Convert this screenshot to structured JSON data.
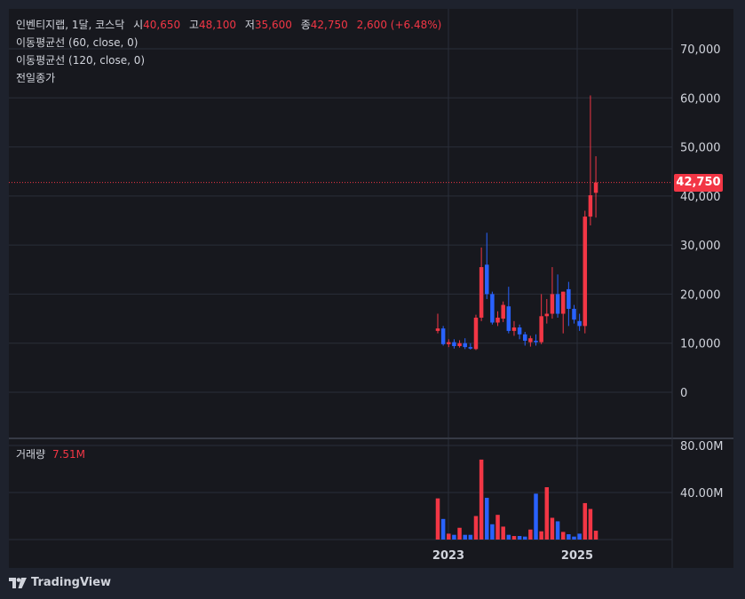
{
  "legend": {
    "symbol": "인벤티지랩, 1달, 코스닥",
    "open_label": "시",
    "open": "40,650",
    "high_label": "고",
    "high": "48,100",
    "low_label": "저",
    "low": "35,600",
    "close_label": "종",
    "close": "42,750",
    "change": "2,600 (+6.48%)",
    "indicators": [
      "이동평균선 (60, close, 0)",
      "이동평균선 (120, close, 0)",
      "전일종가"
    ]
  },
  "volume_legend": {
    "label": "거래량",
    "value": "7.51M"
  },
  "last_price_tag": "42,750",
  "brand": "TradingView",
  "colors": {
    "up": "#f23645",
    "down": "#2962ff",
    "background": "#1e222d",
    "plot_bg": "#17181e",
    "grid": "#2a2e39",
    "text": "#d1d4dc"
  },
  "chart_data": [
    {
      "type": "candlestick",
      "title": "인벤티지랩, 1달, 코스닥",
      "x_ticks": [
        "2023",
        "2025"
      ],
      "y_ticks": [
        "0",
        "10,000",
        "20,000",
        "30,000",
        "40,000",
        "50,000",
        "60,000",
        "70,000"
      ],
      "ylim": [
        -5000,
        78000
      ],
      "last_price": 42750,
      "candles": [
        {
          "o": 12500,
          "h": 16000,
          "l": 12000,
          "c": 13000
        },
        {
          "o": 13000,
          "h": 13500,
          "l": 9500,
          "c": 9800
        },
        {
          "o": 9800,
          "h": 10800,
          "l": 9200,
          "c": 10200
        },
        {
          "o": 10200,
          "h": 10800,
          "l": 8900,
          "c": 9400
        },
        {
          "o": 9400,
          "h": 10600,
          "l": 9100,
          "c": 10000
        },
        {
          "o": 10000,
          "h": 11000,
          "l": 8800,
          "c": 9200
        },
        {
          "o": 9200,
          "h": 10000,
          "l": 8700,
          "c": 8900
        },
        {
          "o": 8800,
          "h": 15800,
          "l": 8600,
          "c": 15200
        },
        {
          "o": 15200,
          "h": 29500,
          "l": 14500,
          "c": 25500
        },
        {
          "o": 26000,
          "h": 32500,
          "l": 19000,
          "c": 20000
        },
        {
          "o": 20000,
          "h": 20500,
          "l": 13800,
          "c": 14200
        },
        {
          "o": 14200,
          "h": 16500,
          "l": 13500,
          "c": 15200
        },
        {
          "o": 15000,
          "h": 18500,
          "l": 14300,
          "c": 17800
        },
        {
          "o": 17500,
          "h": 21500,
          "l": 12000,
          "c": 12500
        },
        {
          "o": 12500,
          "h": 14500,
          "l": 11500,
          "c": 13200
        },
        {
          "o": 13200,
          "h": 13800,
          "l": 10800,
          "c": 11800
        },
        {
          "o": 11800,
          "h": 12300,
          "l": 9500,
          "c": 10500
        },
        {
          "o": 10200,
          "h": 11500,
          "l": 9300,
          "c": 11000
        },
        {
          "o": 10500,
          "h": 11800,
          "l": 9500,
          "c": 10200
        },
        {
          "o": 10200,
          "h": 20000,
          "l": 9800,
          "c": 15500
        },
        {
          "o": 15500,
          "h": 19000,
          "l": 14000,
          "c": 16000
        },
        {
          "o": 16000,
          "h": 25500,
          "l": 15000,
          "c": 20000
        },
        {
          "o": 20000,
          "h": 24000,
          "l": 15200,
          "c": 16000
        },
        {
          "o": 16000,
          "h": 20500,
          "l": 12000,
          "c": 20500
        },
        {
          "o": 21000,
          "h": 22500,
          "l": 13500,
          "c": 17000
        },
        {
          "o": 17000,
          "h": 17800,
          "l": 14000,
          "c": 14800
        },
        {
          "o": 14500,
          "h": 16000,
          "l": 12500,
          "c": 13500
        },
        {
          "o": 13500,
          "h": 37000,
          "l": 12000,
          "c": 35800
        },
        {
          "o": 35800,
          "h": 60500,
          "l": 34000,
          "c": 40150
        },
        {
          "o": 40650,
          "h": 48100,
          "l": 35600,
          "c": 42750
        }
      ]
    },
    {
      "type": "bar",
      "title": "거래량",
      "y_ticks": [
        "40.00M",
        "80.00M"
      ],
      "ylim": [
        0,
        80
      ],
      "unit": "M",
      "values": [
        35,
        17.5,
        5,
        4,
        10,
        4,
        4,
        20,
        68,
        35.5,
        13,
        21,
        11,
        4,
        3,
        3,
        2.5,
        8.5,
        39,
        7,
        44.5,
        18.5,
        15.5,
        6.5,
        4.5,
        2.5,
        5,
        31,
        26,
        7.51
      ]
    }
  ]
}
